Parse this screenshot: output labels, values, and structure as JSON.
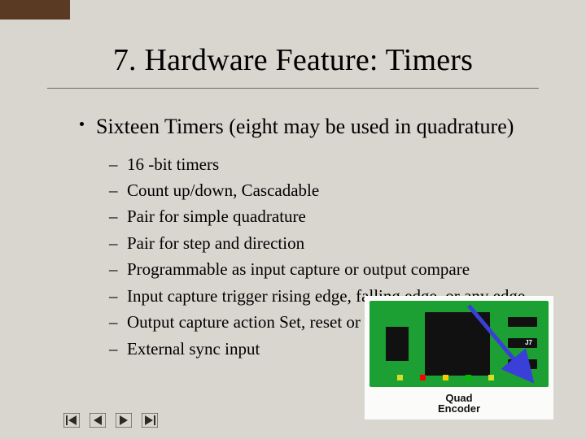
{
  "title": "7. Hardware Feature: Timers",
  "top_bullet": "Sixteen Timers (eight may be used in quadrature)",
  "items": [
    "16 -bit timers",
    "Count up/down, Cascadable",
    "Pair for simple quadrature",
    "Pair for step and direction",
    "Programmable as input capture or output compare",
    "Input capture trigger rising edge, falling edge, or any edge",
    "Output capture action Set, reset or toggle",
    "External sync input"
  ],
  "board": {
    "label": "J7",
    "caption_line1": "Quad",
    "caption_line2": "Encoder"
  }
}
